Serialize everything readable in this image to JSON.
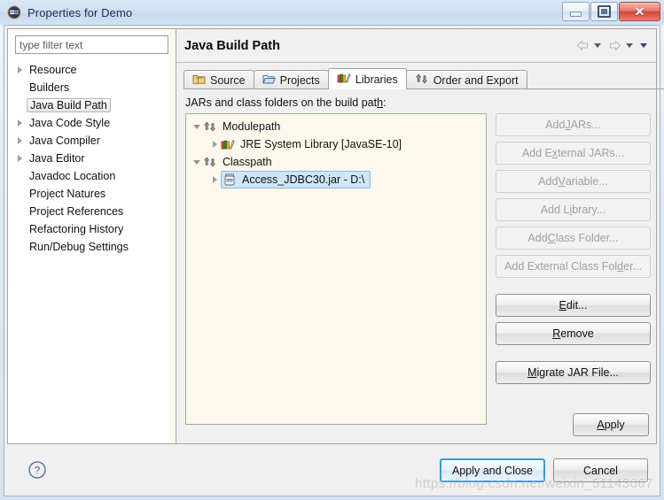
{
  "window": {
    "title": "Properties for Demo",
    "icon": "eclipse-icon",
    "buttons": {
      "minimize": "Minimize",
      "maximize": "Restore",
      "close": "Close"
    }
  },
  "sidebar": {
    "filter": {
      "placeholder": "type filter text",
      "value": ""
    },
    "items": [
      {
        "label": "Resource",
        "expandable": true,
        "selected": false
      },
      {
        "label": "Builders",
        "expandable": false,
        "selected": false
      },
      {
        "label": "Java Build Path",
        "expandable": false,
        "selected": true
      },
      {
        "label": "Java Code Style",
        "expandable": true,
        "selected": false
      },
      {
        "label": "Java Compiler",
        "expandable": true,
        "selected": false
      },
      {
        "label": "Java Editor",
        "expandable": true,
        "selected": false
      },
      {
        "label": "Javadoc Location",
        "expandable": false,
        "selected": false
      },
      {
        "label": "Project Natures",
        "expandable": false,
        "selected": false
      },
      {
        "label": "Project References",
        "expandable": false,
        "selected": false
      },
      {
        "label": "Refactoring History",
        "expandable": false,
        "selected": false
      },
      {
        "label": "Run/Debug Settings",
        "expandable": false,
        "selected": false
      }
    ]
  },
  "page": {
    "title": "Java Build Path",
    "nav": {
      "back": "back-arrow-icon",
      "forward": "forward-arrow-icon",
      "menu": "dropdown-caret-icon"
    },
    "tabs": [
      {
        "label": "Source",
        "icon": "package-folder-icon",
        "active": false
      },
      {
        "label": "Projects",
        "icon": "open-folder-icon",
        "active": false
      },
      {
        "label": "Libraries",
        "icon": "books-icon",
        "active": true
      },
      {
        "label": "Order and Export",
        "icon": "updown-arrows-icon",
        "active": false
      }
    ],
    "description_pre": "JARs and class folders on the build pat",
    "description_mnemonic": "h",
    "description_post": ":",
    "tree": [
      {
        "label": "Modulepath",
        "icon": "updown-arrows-icon",
        "level": 0,
        "twisty": "expanded",
        "selected": false
      },
      {
        "label": "JRE System Library [JavaSE-10]",
        "icon": "books-icon",
        "level": 1,
        "twisty": "collapsed",
        "selected": false
      },
      {
        "label": "Classpath",
        "icon": "updown-arrows-icon",
        "level": 0,
        "twisty": "expanded",
        "selected": false
      },
      {
        "label": "Access_JDBC30.jar - D:\\",
        "icon": "jar-icon",
        "level": 1,
        "twisty": "collapsed",
        "selected": true
      }
    ],
    "side_buttons": [
      {
        "pre": "Add ",
        "mnemonic": "J",
        "post": "ARs...",
        "enabled": false
      },
      {
        "pre": "Add E",
        "mnemonic": "x",
        "post": "ternal JARs...",
        "enabled": false
      },
      {
        "pre": "Add ",
        "mnemonic": "V",
        "post": "ariable...",
        "enabled": false
      },
      {
        "pre": "Add L",
        "mnemonic": "i",
        "post": "brary...",
        "enabled": false
      },
      {
        "pre": "Add ",
        "mnemonic": "C",
        "post": "lass Folder...",
        "enabled": false
      },
      {
        "pre": "Add External Class Fol",
        "mnemonic": "d",
        "post": "er...",
        "enabled": false
      },
      {
        "pre": "",
        "mnemonic": "E",
        "post": "dit...",
        "enabled": true,
        "group_gap": true
      },
      {
        "pre": "",
        "mnemonic": "R",
        "post": "emove",
        "enabled": true
      },
      {
        "pre": "",
        "mnemonic": "M",
        "post": "igrate JAR File...",
        "enabled": true,
        "group_gap": true
      }
    ],
    "apply_button": {
      "pre": "",
      "mnemonic": "A",
      "post": "pply"
    }
  },
  "footer": {
    "help_icon": "help-question-icon",
    "apply_and_close": "Apply and Close",
    "cancel": "Cancel"
  },
  "watermark": "https://blog.csdn.net/weixin_51143067",
  "colors": {
    "selection": "#cfe5fb",
    "tree_background": "#fdf8ec",
    "default_button_border": "#3c9ad6",
    "title_text": "#16314d"
  }
}
